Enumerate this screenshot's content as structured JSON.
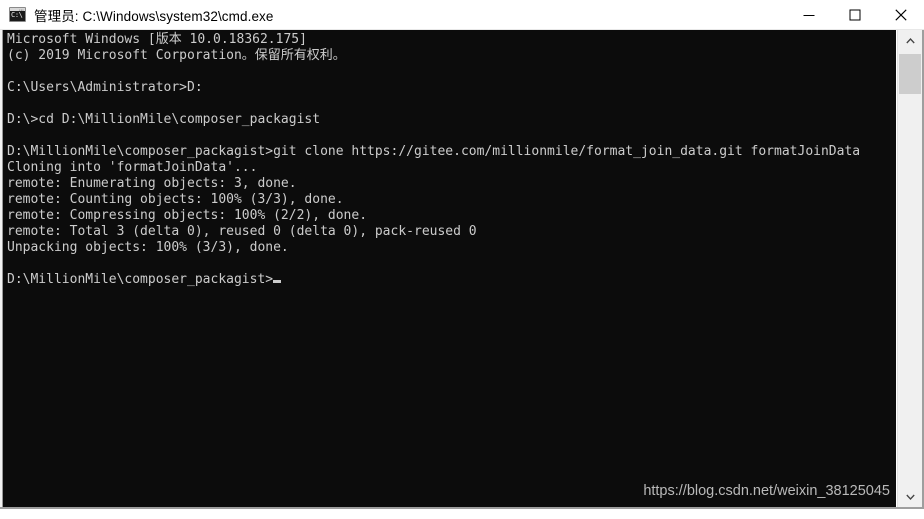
{
  "window": {
    "title": "管理员: C:\\Windows\\system32\\cmd.exe",
    "icon_name": "cmd-icon",
    "icon_text": "C:\\",
    "background_color": "#0c0c0c",
    "text_color": "#cccccc"
  },
  "controls": {
    "minimize_label": "最小化",
    "maximize_label": "最大化",
    "close_label": "关闭"
  },
  "console": {
    "lines": [
      "Microsoft Windows [版本 10.0.18362.175]",
      "(c) 2019 Microsoft Corporation。保留所有权利。",
      "",
      "C:\\Users\\Administrator>D:",
      "",
      "D:\\>cd D:\\MillionMile\\composer_packagist",
      "",
      "D:\\MillionMile\\composer_packagist>git clone https://gitee.com/millionmile/format_join_data.git formatJoinData",
      "Cloning into 'formatJoinData'...",
      "remote: Enumerating objects: 3, done.",
      "remote: Counting objects: 100% (3/3), done.",
      "remote: Compressing objects: 100% (2/2), done.",
      "remote: Total 3 (delta 0), reused 0 (delta 0), pack-reused 0",
      "Unpacking objects: 100% (3/3), done.",
      "",
      "D:\\MillionMile\\composer_packagist>"
    ],
    "prompt_last": "D:\\MillionMile\\composer_packagist>",
    "cursor": "_"
  },
  "watermark": {
    "text": "https://blog.csdn.net/weixin_38125045"
  },
  "scrollbar": {
    "up_arrow": "⌃",
    "down_arrow": "⌄",
    "thumb_position": "top"
  }
}
